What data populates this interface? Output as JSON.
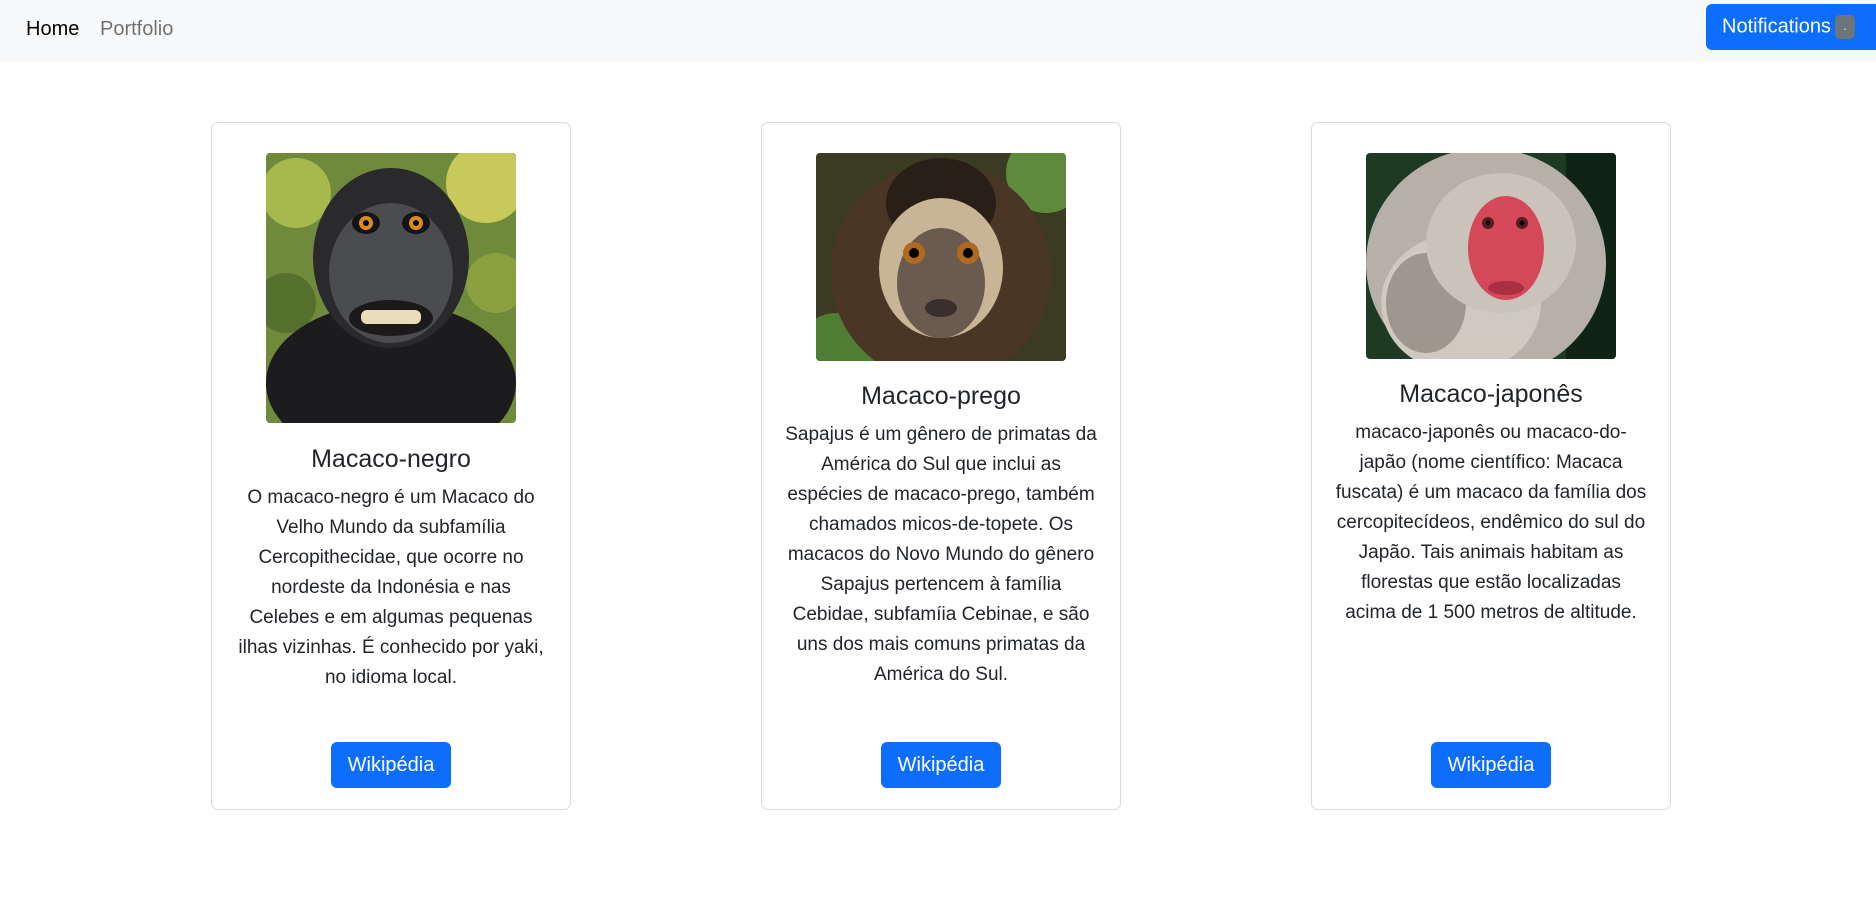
{
  "nav": {
    "home": "Home",
    "portfolio": "Portfolio",
    "notifications": "Notifications",
    "badge": "."
  },
  "cards": [
    {
      "title": "Macaco-negro",
      "text": "O macaco-negro é um Macaco do Velho Mundo da subfamília Cercopithecidae, que ocorre no nordeste da Indonésia e nas Celebes e em algumas pequenas ilhas vizinhas. É conhecido por yaki, no idioma local.",
      "button": "Wikipédia"
    },
    {
      "title": "Macaco-prego",
      "text": "Sapajus é um gênero de primatas da América do Sul que inclui as espécies de macaco-prego, também chamados micos-de-topete. Os macacos do Novo Mundo do gênero Sapajus pertencem à família Cebidae, subfamíia Cebinae, e são uns dos mais comuns primatas da América do Sul.",
      "button": "Wikipédia"
    },
    {
      "title": "Macaco-japonês",
      "text": "macaco-japonês ou macaco-do-japão (nome científico: Macaca fuscata) é um macaco da família dos cercopitecídeos, endêmico do sul do Japão. Tais animais habitam as florestas que estão localizadas acima de 1 500 metros de altitude.",
      "button": "Wikipédia"
    }
  ]
}
